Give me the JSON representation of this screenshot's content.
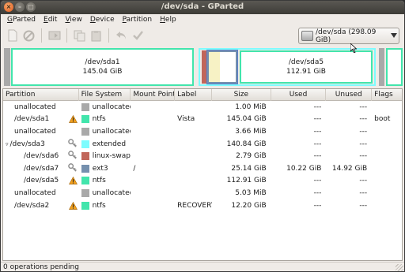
{
  "window": {
    "title": "/dev/sda - GParted"
  },
  "titlebar_buttons": [
    "×",
    "–",
    "□"
  ],
  "menu": [
    {
      "u": "G",
      "rest": "Parted"
    },
    {
      "u": "E",
      "rest": "dit"
    },
    {
      "u": "V",
      "rest": "iew"
    },
    {
      "u": "D",
      "rest": "evice"
    },
    {
      "u": "P",
      "rest": "artition"
    },
    {
      "u": "H",
      "rest": "elp"
    }
  ],
  "toolbar": {
    "buttons": [
      "new-icon",
      "delete-icon",
      "resize-move-icon",
      "copy-icon",
      "paste-icon",
      "undo-icon",
      "apply-icon"
    ],
    "device_selector": "/dev/sda  (298.09 GiB)"
  },
  "map": {
    "sda1": {
      "name": "/dev/sda1",
      "size": "145.04 GiB"
    },
    "sda5": {
      "name": "/dev/sda5",
      "size": "112.91 GiB"
    }
  },
  "table": {
    "headers": {
      "partition": "Partition",
      "filesystem": "File System",
      "mountpoint": "Mount Point",
      "label": "Label",
      "size": "Size",
      "used": "Used",
      "unused": "Unused",
      "flags": "Flags"
    },
    "rows": [
      {
        "partition": "unallocated",
        "indent": 1,
        "fs": "unallocated",
        "fs_color": "#a9a9a9",
        "mount": "",
        "label": "",
        "size": "1.00 MiB",
        "used": "---",
        "unused": "---",
        "flags": "",
        "icon": ""
      },
      {
        "partition": "/dev/sda1",
        "indent": 1,
        "fs": "ntfs",
        "fs_color": "#42e5ac",
        "mount": "",
        "label": "Vista",
        "size": "145.04 GiB",
        "used": "---",
        "unused": "---",
        "flags": "boot",
        "icon": "warning"
      },
      {
        "partition": "unallocated",
        "indent": 1,
        "fs": "unallocated",
        "fs_color": "#a9a9a9",
        "mount": "",
        "label": "",
        "size": "3.66 MiB",
        "used": "---",
        "unused": "---",
        "flags": "",
        "icon": ""
      },
      {
        "partition": "/dev/sda3",
        "indent": 0,
        "fs": "extended",
        "fs_color": "#7dfcfe",
        "mount": "",
        "label": "",
        "size": "140.84 GiB",
        "used": "---",
        "unused": "---",
        "flags": "",
        "icon": "key",
        "expander": "▿"
      },
      {
        "partition": "/dev/sda6",
        "indent": 2,
        "fs": "linux-swap",
        "fs_color": "#c1665a",
        "mount": "",
        "label": "",
        "size": "2.79 GiB",
        "used": "---",
        "unused": "---",
        "flags": "",
        "icon": "key"
      },
      {
        "partition": "/dev/sda7",
        "indent": 2,
        "fs": "ext3",
        "fs_color": "#7590ae",
        "mount": "/",
        "label": "",
        "size": "25.14 GiB",
        "used": "10.22 GiB",
        "unused": "14.92 GiB",
        "flags": "",
        "icon": "key"
      },
      {
        "partition": "/dev/sda5",
        "indent": 2,
        "fs": "ntfs",
        "fs_color": "#42e5ac",
        "mount": "",
        "label": "",
        "size": "112.91 GiB",
        "used": "---",
        "unused": "---",
        "flags": "",
        "icon": "warning"
      },
      {
        "partition": "unallocated",
        "indent": 1,
        "fs": "unallocated",
        "fs_color": "#a9a9a9",
        "mount": "",
        "label": "",
        "size": "5.03 MiB",
        "used": "---",
        "unused": "---",
        "flags": "",
        "icon": ""
      },
      {
        "partition": "/dev/sda2",
        "indent": 1,
        "fs": "ntfs",
        "fs_color": "#42e5ac",
        "mount": "",
        "label": "RECOVERY",
        "size": "12.20 GiB",
        "used": "---",
        "unused": "---",
        "flags": "",
        "icon": "warning"
      }
    ]
  },
  "status": "0 operations pending"
}
